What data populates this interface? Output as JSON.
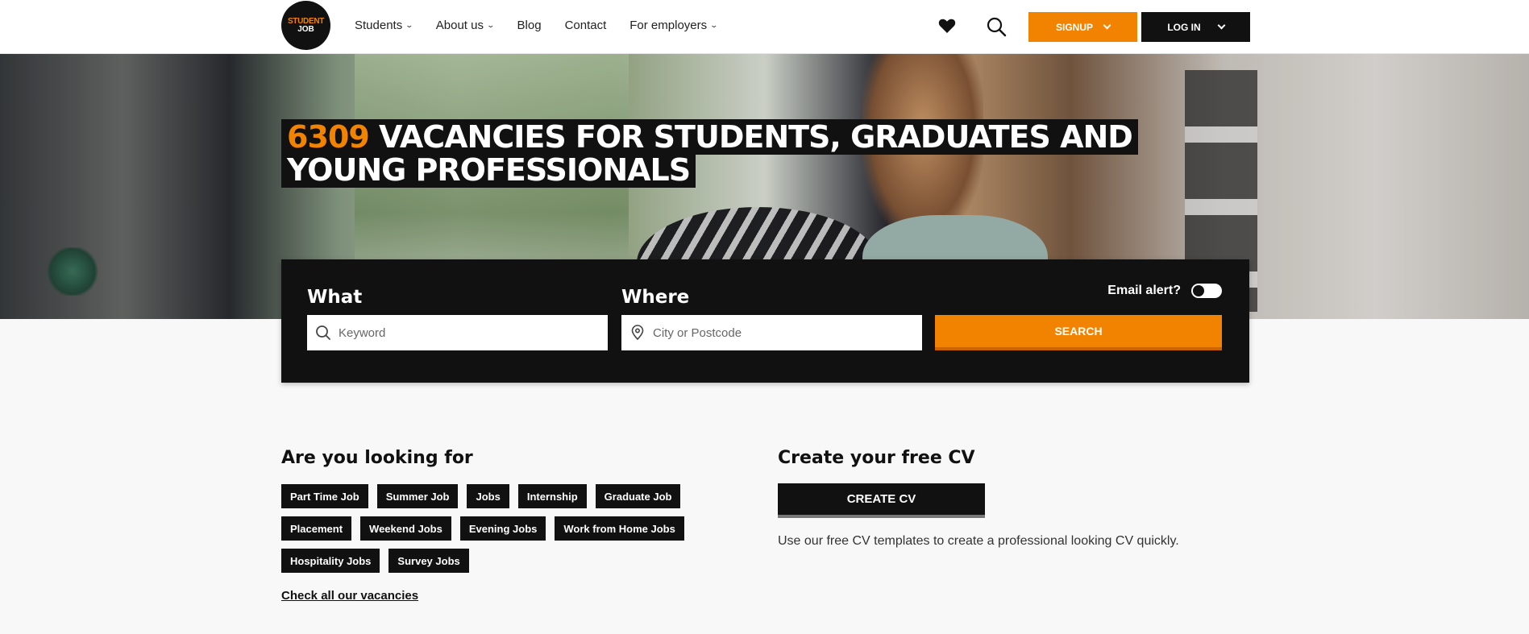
{
  "header": {
    "logo_line1": "STUDENT",
    "logo_line2": "JOB",
    "nav": [
      {
        "label": "Students",
        "has_dropdown": true
      },
      {
        "label": "About us",
        "has_dropdown": true
      },
      {
        "label": "Blog",
        "has_dropdown": false
      },
      {
        "label": "Contact",
        "has_dropdown": false
      },
      {
        "label": "For employers",
        "has_dropdown": true
      }
    ],
    "signup_label": "SIGNUP",
    "login_label": "LOG IN",
    "icons": [
      "heart-icon",
      "search-icon"
    ]
  },
  "hero": {
    "count": "6309",
    "title_rest": " VACANCIES FOR STUDENTS, GRADUATES AND YOUNG PROFESSIONALS"
  },
  "search": {
    "what_label": "What",
    "what_placeholder": "Keyword",
    "where_label": "Where",
    "where_placeholder": "City or Postcode",
    "email_alert_label": "Email alert?",
    "email_alert_on": false,
    "search_label": "SEARCH"
  },
  "looking": {
    "title": "Are you looking for",
    "tags": [
      "Part Time Job",
      "Summer Job",
      "Jobs",
      "Internship",
      "Graduate Job",
      "Placement",
      "Weekend Jobs",
      "Evening Jobs",
      "Work from Home Jobs",
      "Hospitality Jobs",
      "Survey Jobs"
    ],
    "check_all_label": "Check all our vacancies"
  },
  "cv": {
    "title": "Create your free CV",
    "button_label": "CREATE CV",
    "description": "Use our free CV templates to create a professional looking CV quickly."
  },
  "colors": {
    "accent": "#f28300",
    "dark": "#111111",
    "background": "#f8f8f8"
  }
}
